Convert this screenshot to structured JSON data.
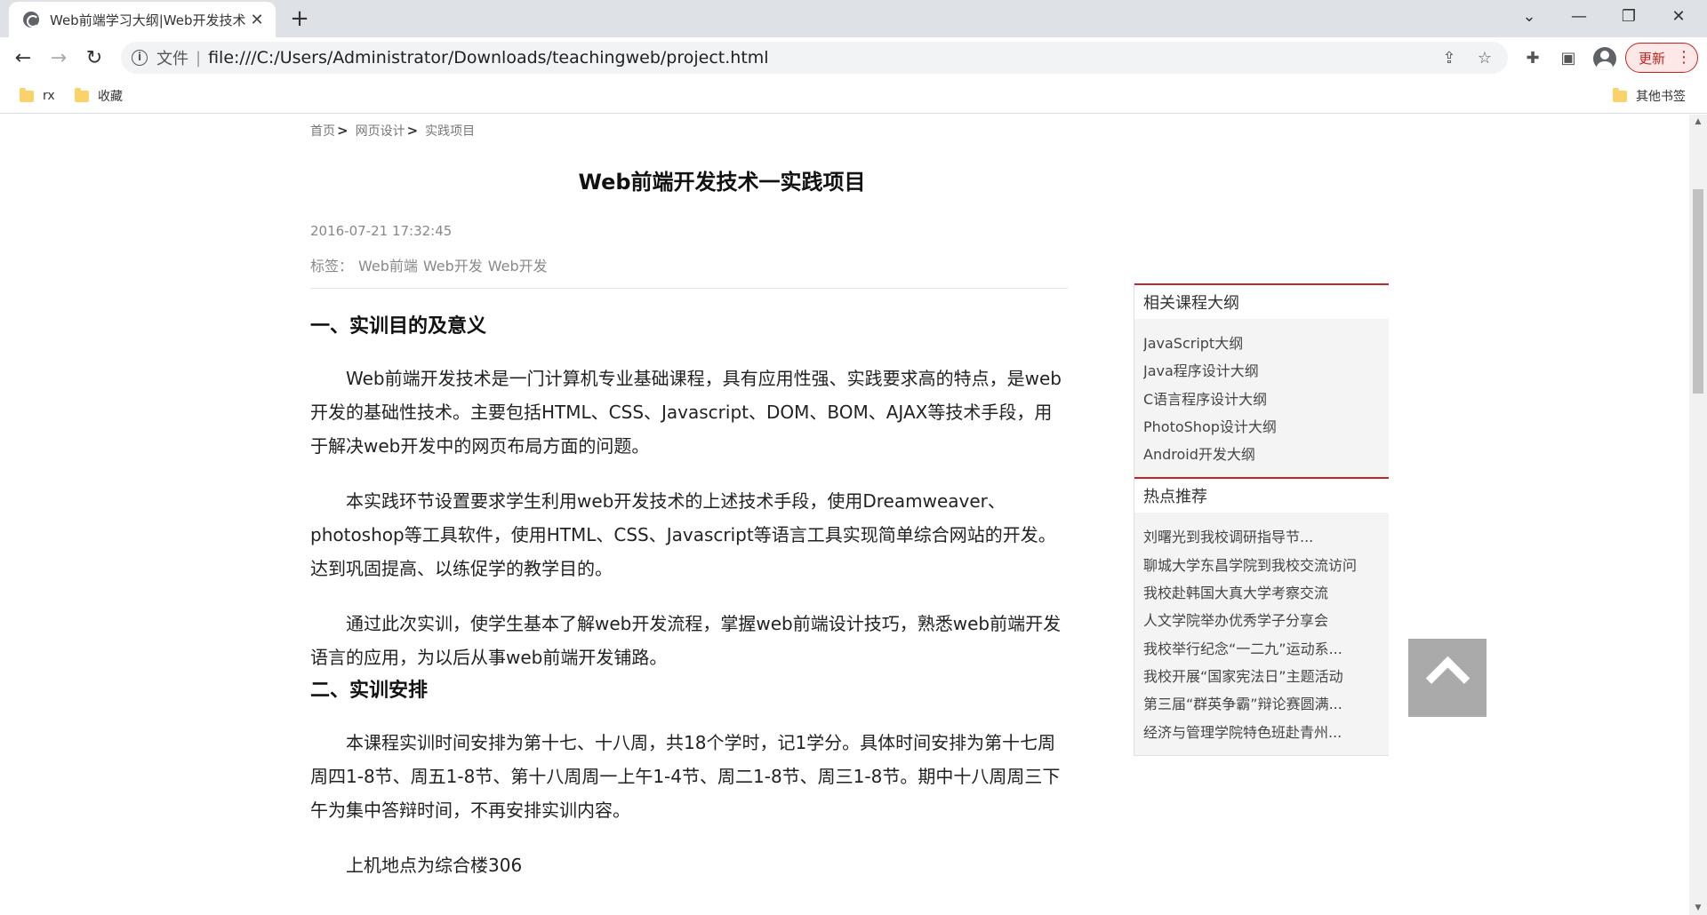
{
  "browser": {
    "tab_title": "Web前端学习大纲|Web开发技术",
    "tab_close": "✕",
    "new_tab": "+",
    "url_scheme": "文件",
    "url_sep": "|",
    "url": "file:///C:/Users/Administrator/Downloads/teachingweb/project.html",
    "update_label": "更新",
    "bookmarks": [
      {
        "label": "rx"
      },
      {
        "label": "收藏"
      }
    ],
    "other_bookmarks": "其他书签"
  },
  "page": {
    "breadcrumb": [
      "首页",
      "网页设计",
      "实践项目"
    ],
    "breadcrumb_sep": ">",
    "title": "Web前端开发技术一实践项目",
    "date": "2016-07-21 17:32:45",
    "tags_label": "标签：",
    "tags": [
      "Web前端",
      "Web开发",
      "Web开发"
    ],
    "sections": [
      {
        "heading": "一、实训目的及意义",
        "paragraphs": [
          "Web前端开发技术是一门计算机专业基础课程，具有应用性强、实践要求高的特点，是web开发的基础性技术。主要包括HTML、CSS、Javascript、DOM、BOM、AJAX等技术手段，用于解决web开发中的网页布局方面的问题。",
          "本实践环节设置要求学生利用web开发技术的上述技术手段，使用Dreamweaver、photoshop等工具软件，使用HTML、CSS、Javascript等语言工具实现简单综合网站的开发。达到巩固提高、以练促学的教学目的。",
          "通过此次实训，使学生基本了解web开发流程，掌握web前端设计技巧，熟悉web前端开发语言的应用，为以后从事web前端开发铺路。"
        ]
      },
      {
        "heading": "二、实训安排",
        "paragraphs": [
          "本课程实训时间安排为第十七、十八周，共18个学时，记1学分。具体时间安排为第十七周周四1-8节、周五1-8节、第十八周周一上午1-4节、周二1-8节、周三1-8节。期中十八周周三下午为集中答辩时间，不再安排实训内容。",
          "上机地点为综合楼306"
        ]
      }
    ]
  },
  "sidebar": {
    "related_title": "相关课程大纲",
    "related": [
      "JavaScript大纲",
      "Java程序设计大纲",
      "C语言程序设计大纲",
      "PhotoShop设计大纲",
      "Android开发大纲"
    ],
    "hot_title": "热点推荐",
    "hot": [
      "刘曙光到我校调研指导节...",
      "聊城大学东昌学院到我校交流访问",
      "我校赴韩国大真大学考察交流",
      "人文学院举办优秀学子分享会",
      "我校举行纪念“一二九”运动系...",
      "我校开展“国家宪法日”主题活动",
      "第三届“群英争霸”辩论赛圆满...",
      "经济与管理学院特色班赴青州..."
    ]
  },
  "icons": {
    "back": "arrow-left-icon",
    "forward": "arrow-right-icon",
    "reload": "reload-icon",
    "info": "info-icon",
    "share": "share-icon",
    "star": "star-icon",
    "extensions": "puzzle-icon",
    "side_panel": "side-panel-icon",
    "back_to_top": "chevron-up-icon"
  }
}
